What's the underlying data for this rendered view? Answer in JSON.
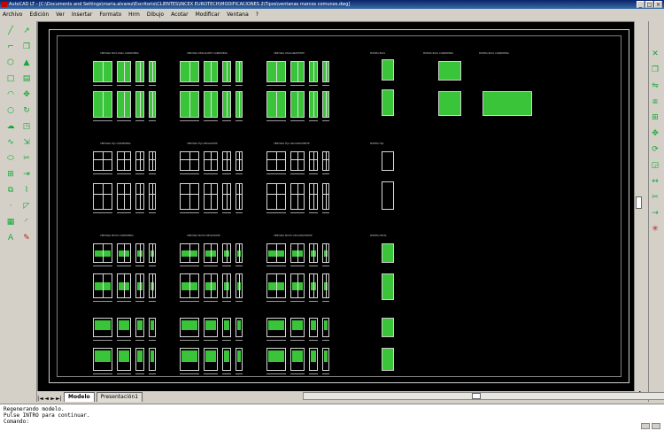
{
  "titlebar": {
    "text": "AutoCAD LT - [C:\\Documents and Settings\\maria.alvarez\\Escritorio\\CLIENTES\\INCEX EUROTECH\\MODIFICACIONES 2\\Tipos\\ventanas marcos comunes.dwg]"
  },
  "menu": [
    "Archivo",
    "Edición",
    "Ver",
    "Insertar",
    "Formato",
    "Hrm",
    "Dibujo",
    "Acotar",
    "Modificar",
    "Ventana",
    "?"
  ],
  "window_buttons": [
    "_",
    "□",
    "×"
  ],
  "layout_tabs": {
    "nav": [
      "|◄",
      "◄",
      "►",
      "►|"
    ],
    "tabs": [
      "Modelo",
      "Presentación1"
    ]
  },
  "command_lines": [
    "Regenerando modelo.",
    "Pulse INTRO para continuar.",
    "Comando:"
  ],
  "drawing": {
    "group_titles": [
      "VENTANA BAYA PARA CORREDERA",
      "VENTANA DESLIZANTE CORREDERA",
      "VENTANA OSCILOBATIENTE",
      "PUERTA BAYA",
      "PUERTA BAYA CORREDERA",
      "PUERTA BAYA CORREDERA",
      "VENTANA FIJA CORREDERA",
      "VENTANA FIJA DESLIZANTE",
      "VENTANA FIJA OSCILOBATIENTE",
      "PUERTA FIJA",
      "VENTANA MIXTA CORREDERA",
      "VENTANA MIXTA DESLIZANTE",
      "VENTANA MIXTA OSCILOBATIENTE",
      "PUERTA MIXTA"
    ]
  },
  "colors": {
    "drawing_bg": "#000000",
    "fill": "#3ac43a",
    "line": "#d8d8d8"
  }
}
